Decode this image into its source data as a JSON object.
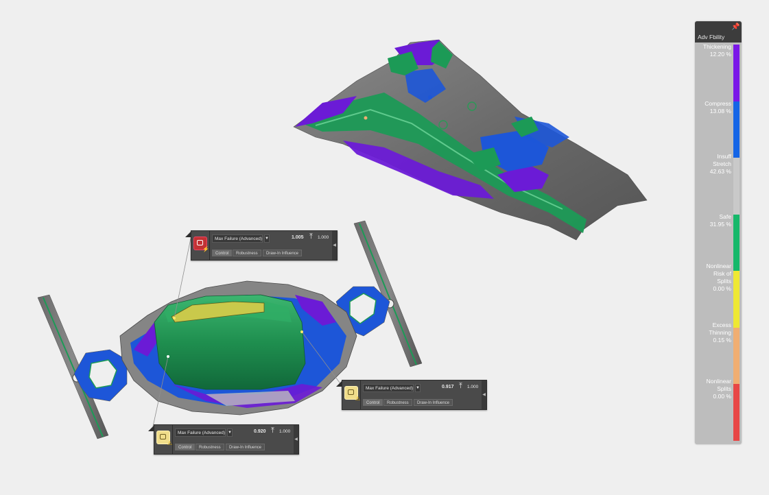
{
  "legend": {
    "title": "Adv Fbility",
    "pin_icon": "pin-icon",
    "items": [
      {
        "label": "Thickening\n12.20 %",
        "color": "#7a17e8"
      },
      {
        "label": "Compress\n13.08 %",
        "color": "#1565e6"
      },
      {
        "label": "Insuff\nStretch\n42.63 %",
        "color": "#c9c9c9"
      },
      {
        "label": "Safe\n31.95 %",
        "color": "#16b86a"
      },
      {
        "label": "Nonlinear\nRisk of\nSplits\n0.00 %",
        "color": "#eee833"
      },
      {
        "label": "Excess\nThinning\n0.15 %",
        "color": "#f0ae72"
      },
      {
        "label": "Nonlinear\nSplits\n0.00 %",
        "color": "#e84646"
      }
    ]
  },
  "panels": [
    {
      "status_icon": "split-warning-icon",
      "status_color": "#c23234",
      "criterion": "Max Failure (Advanced)",
      "value": "1.005",
      "threshold": "1.000",
      "tabs": [
        "Control",
        "Robustness",
        "Draw-In Influence"
      ]
    },
    {
      "status_icon": "caution-icon",
      "status_color": "#f0dd8a",
      "criterion": "Max Failure (Advanced)",
      "value": "0.917",
      "threshold": "1.000",
      "tabs": [
        "Control",
        "Robustness",
        "Draw-In Influence"
      ]
    },
    {
      "status_icon": "caution-icon",
      "status_color": "#f0dd8a",
      "criterion": "Max Failure (Advanced)",
      "value": "0.920",
      "threshold": "1.000",
      "tabs": [
        "Control",
        "Robustness",
        "Draw-In Influence"
      ]
    }
  ]
}
